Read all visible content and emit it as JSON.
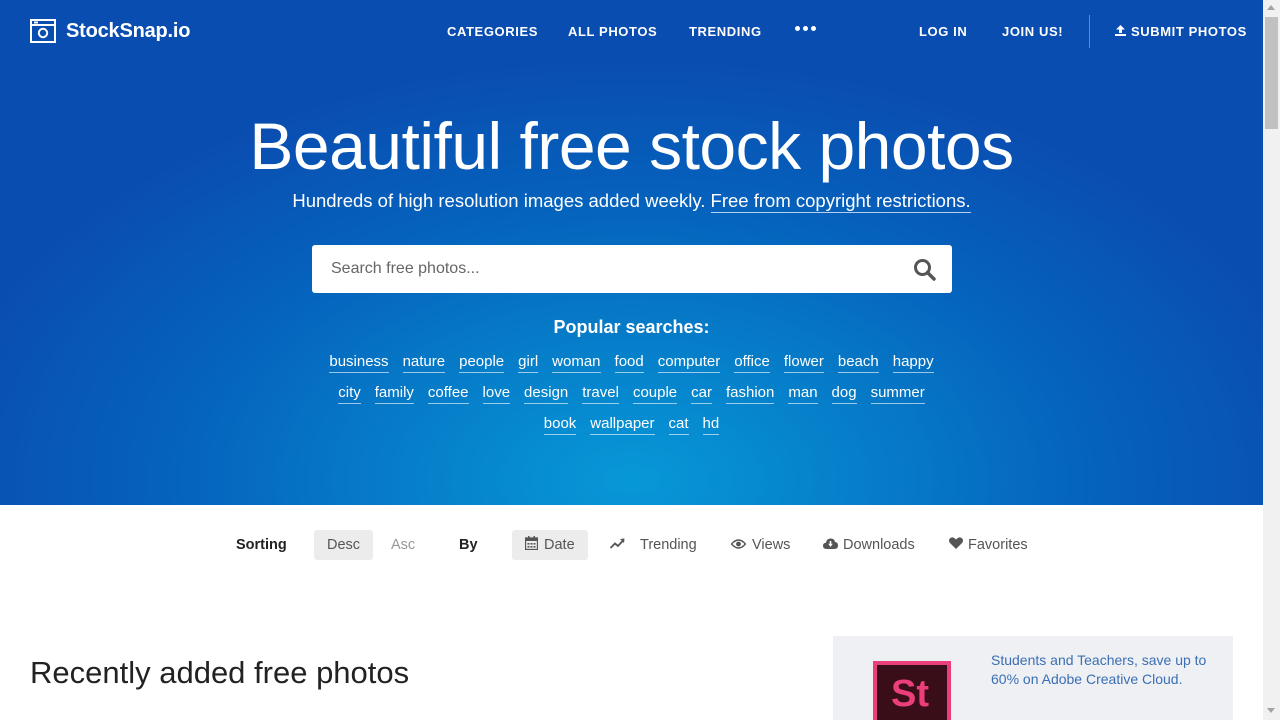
{
  "header": {
    "logo_text": "StockSnap.io",
    "nav": [
      "CATEGORIES",
      "ALL PHOTOS",
      "TRENDING"
    ],
    "more_icon": "ellipsis-icon",
    "login": "LOG IN",
    "join": "JOIN US!",
    "submit": "SUBMIT PHOTOS"
  },
  "hero": {
    "title": "Beautiful free stock photos",
    "subtitle": "Hundreds of high resolution images added weekly.",
    "subtitle_link": "Free from copyright restrictions.",
    "search_placeholder": "Search free photos...",
    "popular_title": "Popular searches:",
    "tags": [
      [
        "business",
        "nature",
        "people",
        "girl",
        "woman",
        "food",
        "computer",
        "office",
        "flower",
        "beach",
        "happy"
      ],
      [
        "city",
        "family",
        "coffee",
        "love",
        "design",
        "travel",
        "couple",
        "car",
        "fashion",
        "man",
        "dog",
        "summer"
      ],
      [
        "book",
        "wallpaper",
        "cat",
        "hd"
      ]
    ]
  },
  "sorting": {
    "label": "Sorting",
    "desc": "Desc",
    "asc": "Asc",
    "by_label": "By",
    "options": {
      "date": "Date",
      "trending": "Trending",
      "views": "Views",
      "downloads": "Downloads",
      "favorites": "Favorites"
    }
  },
  "main": {
    "section_title": "Recently added free photos"
  },
  "ad": {
    "logo_text": "St",
    "text": "Students and Teachers, save up to 60% on Adobe Creative Cloud."
  },
  "colors": {
    "hero_blue": "#0563bd",
    "hero_light": "#0798d8",
    "ad_pink": "#ea3f7b",
    "ad_link": "#3b6fb5"
  }
}
